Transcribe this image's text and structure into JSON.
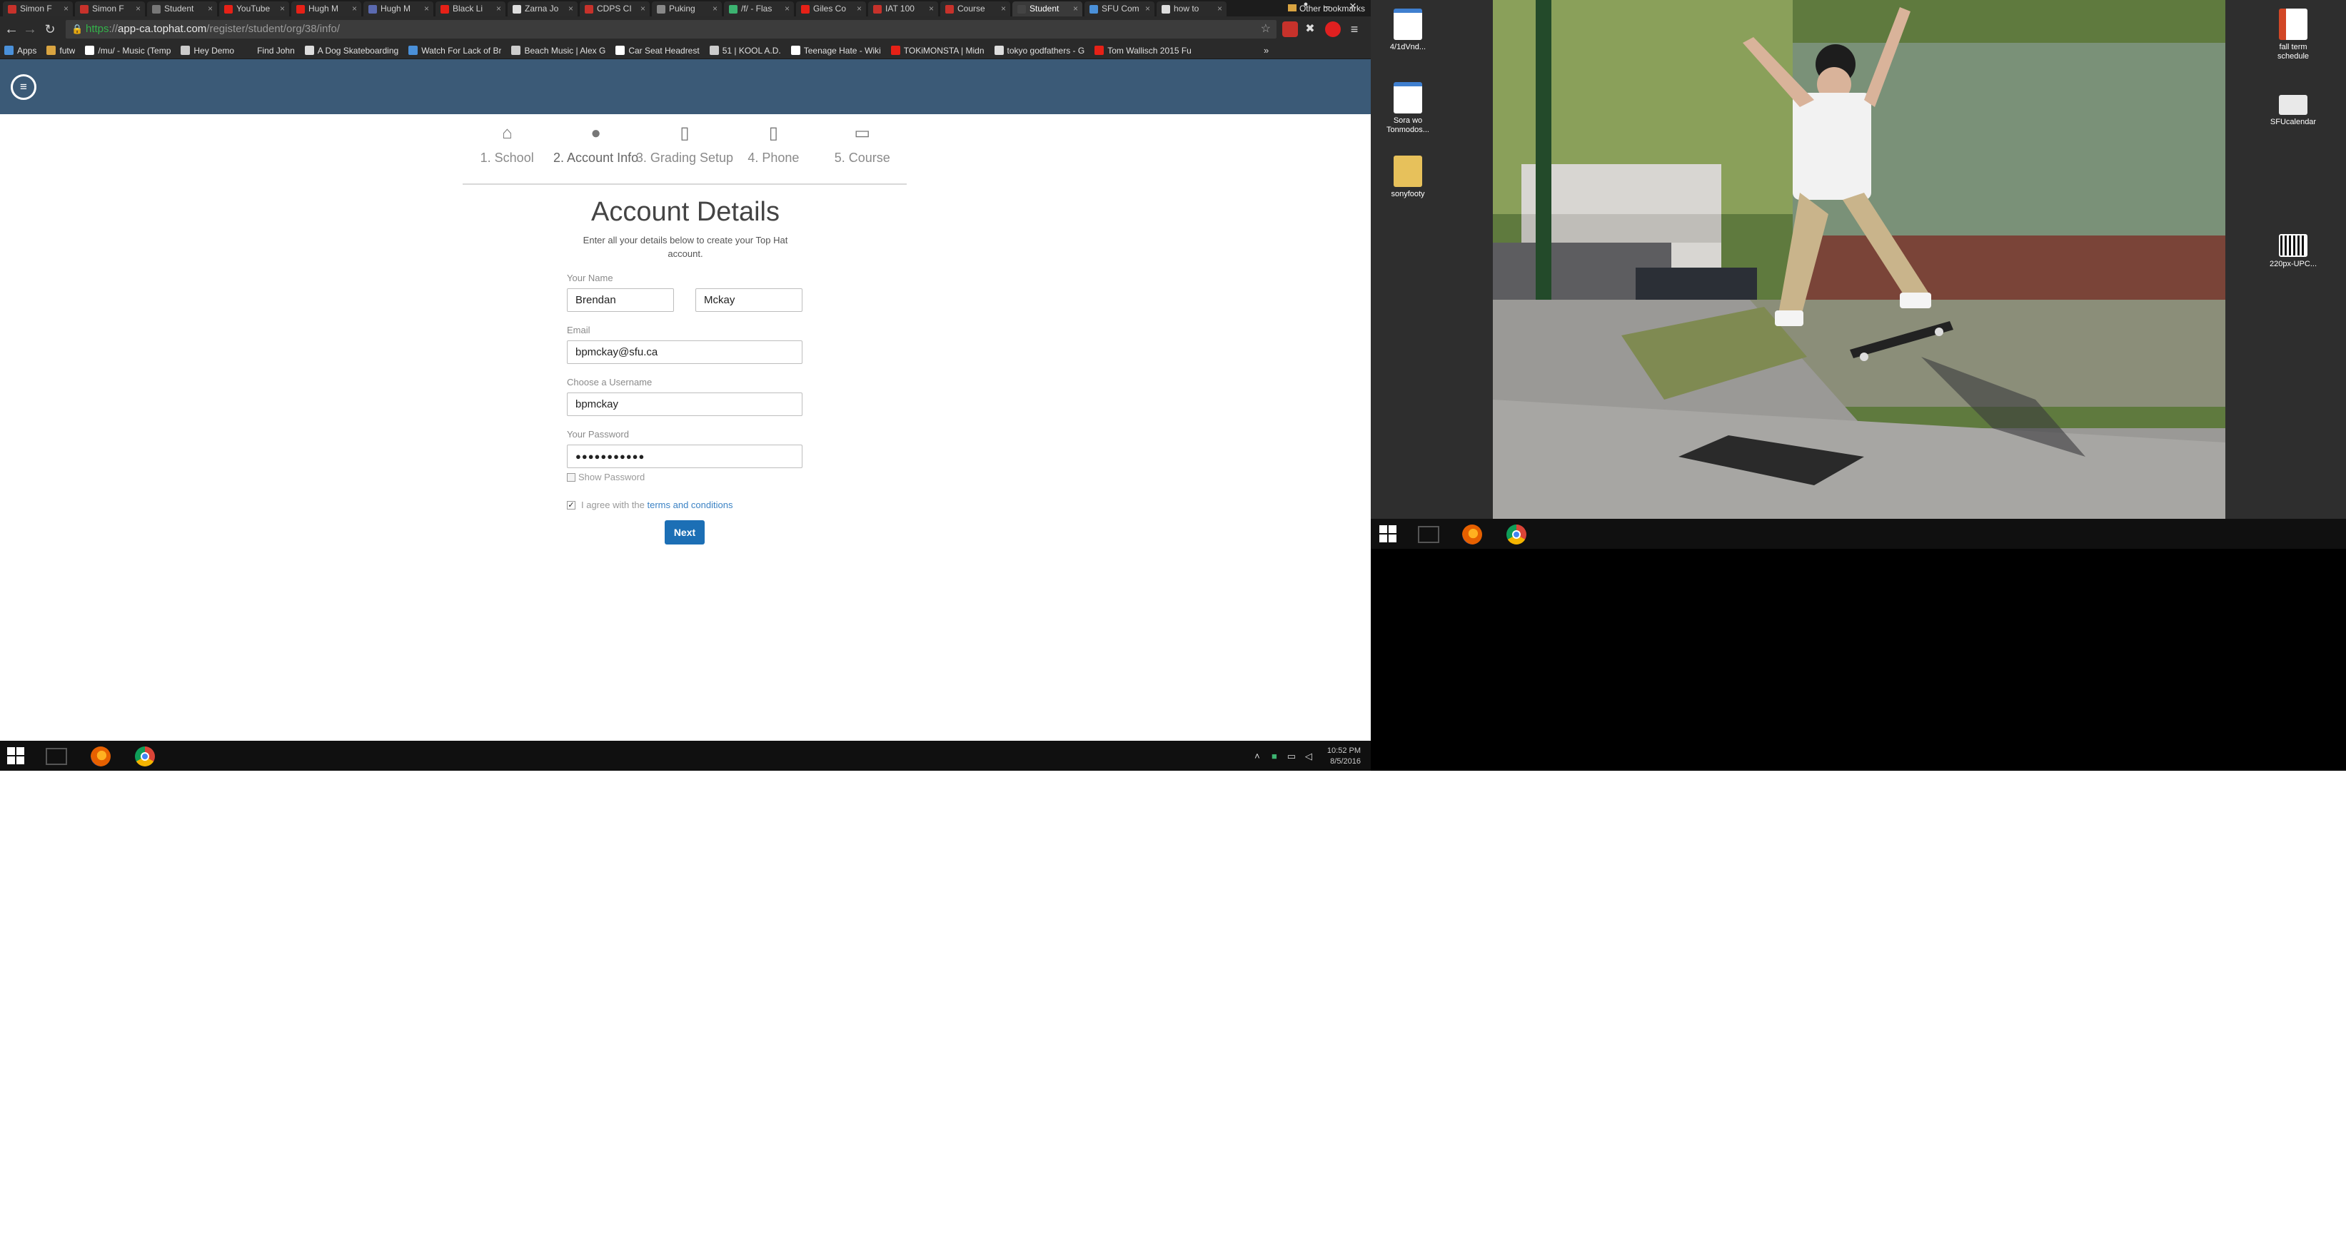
{
  "browser": {
    "tabs": [
      {
        "label": "Simon F",
        "color": "#c7322b"
      },
      {
        "label": "Simon F",
        "color": "#c7322b"
      },
      {
        "label": "Student",
        "color": "#777777"
      },
      {
        "label": "YouTube",
        "color": "#e62117"
      },
      {
        "label": "Hugh M",
        "color": "#e62117"
      },
      {
        "label": "Hugh M",
        "color": "#5b6ab0"
      },
      {
        "label": "Black Li",
        "color": "#e62117"
      },
      {
        "label": "Zarna Jo",
        "color": "#dddddd"
      },
      {
        "label": "CDPS CI",
        "color": "#c7322b"
      },
      {
        "label": "Puking",
        "color": "#888888"
      },
      {
        "label": "/f/ - Flas",
        "color": "#3cb371"
      },
      {
        "label": "Giles Co",
        "color": "#e62117"
      },
      {
        "label": "IAT 100",
        "color": "#c7322b"
      },
      {
        "label": "Course",
        "color": "#c7322b"
      },
      {
        "label": "Student",
        "color": "#444444"
      },
      {
        "label": "SFU Com",
        "color": "#4a90d9"
      },
      {
        "label": "how to",
        "color": "#dddddd"
      }
    ],
    "active_tab_index": 14,
    "url_scheme": "https",
    "url_host": "app-ca.tophat.com",
    "url_path": "/register/student/org/38/info/",
    "bookmarks": [
      {
        "label": "Apps",
        "color": "#4a90d9"
      },
      {
        "label": "futw",
        "color": "#d9a441"
      },
      {
        "label": "/mu/ - Music (Temp",
        "color": "#ffffff"
      },
      {
        "label": "Hey Demo",
        "color": "#cccccc"
      },
      {
        "label": "Find John",
        "color": "#2a2a2a"
      },
      {
        "label": "A Dog Skateboarding",
        "color": "#dddddd"
      },
      {
        "label": "Watch For Lack of Br",
        "color": "#4a90d9"
      },
      {
        "label": "Beach Music | Alex G",
        "color": "#cccccc"
      },
      {
        "label": "Car Seat Headrest",
        "color": "#ffffff"
      },
      {
        "label": "51 | KOOL A.D.",
        "color": "#cccccc"
      },
      {
        "label": "Teenage Hate - Wiki",
        "color": "#ffffff"
      },
      {
        "label": "TOKiMONSTA | Midn",
        "color": "#e62117"
      },
      {
        "label": "tokyo godfathers - G",
        "color": "#dddddd"
      },
      {
        "label": "Tom Wallisch 2015 Fu",
        "color": "#e62117"
      }
    ],
    "more_bookmarks": "»",
    "other_bookmarks": "Other bookmarks"
  },
  "app": {
    "steps": [
      {
        "label": "1. School",
        "icon": "home-icon",
        "glyph": "⌂"
      },
      {
        "label": "2. Account Info",
        "icon": "user-icon",
        "glyph": "●"
      },
      {
        "label": "3. Grading Setup",
        "icon": "book-icon",
        "glyph": "▯"
      },
      {
        "label": "4. Phone",
        "icon": "phone-icon",
        "glyph": "▯"
      },
      {
        "label": "5. Course",
        "icon": "window-icon",
        "glyph": "▭"
      }
    ],
    "active_step": 1,
    "form": {
      "title": "Account Details",
      "subtitle": "Enter all your details below to create your Top Hat account.",
      "name_label": "Your Name",
      "first_name": "Brendan",
      "last_name": "Mckay",
      "email_label": "Email",
      "email": "bpmckay@sfu.ca",
      "username_label": "Choose a Username",
      "username": "bpmckay",
      "password_label": "Your Password",
      "password_mask": "●●●●●●●●●●●",
      "show_password": "Show Password",
      "agree_prefix": "I agree with the",
      "agree_link": "terms and conditions",
      "agree_checked": true,
      "next": "Next"
    }
  },
  "taskbar_left": {
    "clock_time": "10:52 PM",
    "clock_date": "8/5/2016"
  },
  "desktop": {
    "icons_left": [
      {
        "label": "4/1dVnd...",
        "kind": "mp3"
      },
      {
        "label": "Sora wo Tonmodos...",
        "kind": "mp3"
      },
      {
        "label": "sonyfooty",
        "kind": "folder"
      }
    ],
    "icons_right": [
      {
        "label": "fall term schedule",
        "kind": "pptx"
      },
      {
        "label": "SFUcalendar",
        "kind": "image"
      },
      {
        "label": "220px-UPC...",
        "kind": "barcode"
      }
    ]
  },
  "colors": {
    "header": "#3b5a77",
    "primary_button": "#1c6fb5",
    "link": "#3b82c4",
    "https_green": "#33b24a"
  }
}
